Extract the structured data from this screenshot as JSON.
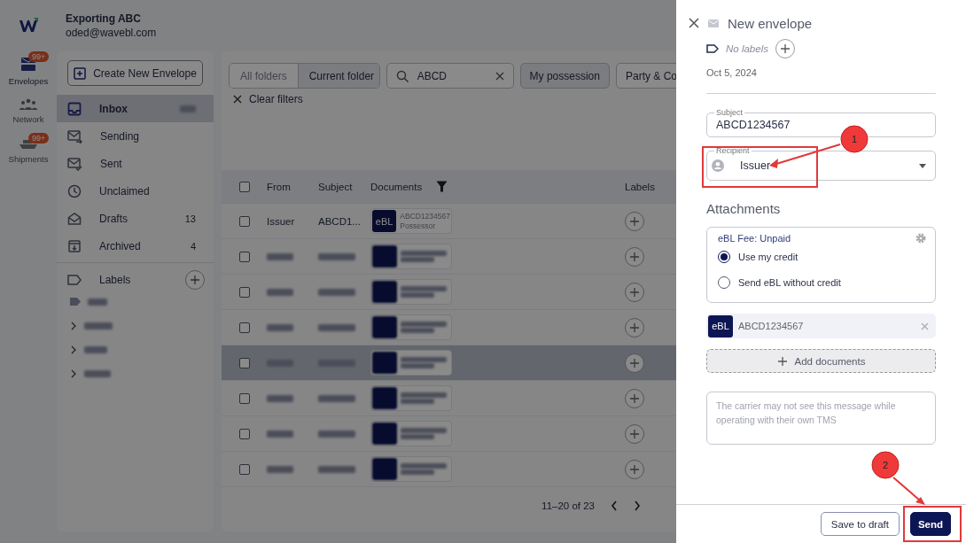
{
  "account": {
    "name": "Exporting ABC",
    "email": "oded@wavebl.com"
  },
  "rail": [
    {
      "label": "Envelopes",
      "badge": "99+",
      "selected": true
    },
    {
      "label": "Network",
      "selected": false
    },
    {
      "label": "Shipments",
      "badge": "99+",
      "selected": false
    }
  ],
  "create_button": "Create New Envelope",
  "folders": [
    {
      "label": "Inbox",
      "selected": true,
      "count_redacted": true
    },
    {
      "label": "Sending",
      "selected": false
    },
    {
      "label": "Sent",
      "selected": false
    },
    {
      "label": "Unclaimed",
      "selected": false
    },
    {
      "label": "Drafts",
      "selected": false,
      "count": "13"
    },
    {
      "label": "Archived",
      "selected": false,
      "count": "4"
    }
  ],
  "labels_section": {
    "title": "Labels",
    "items": [
      {
        "kind": "tag"
      },
      {
        "kind": "group"
      },
      {
        "kind": "group"
      },
      {
        "kind": "group"
      }
    ]
  },
  "scope_toggle": [
    {
      "label": "All folders",
      "selected": false
    },
    {
      "label": "Current folder",
      "selected": true
    }
  ],
  "search": {
    "value": "ABCD"
  },
  "filter_chips": [
    {
      "label": "My possession",
      "selected": true
    },
    {
      "label": "Party & Co",
      "selected": false
    }
  ],
  "clear_filters": "Clear filters",
  "table": {
    "columns": [
      "From",
      "Subject",
      "Documents",
      "Labels"
    ],
    "select_all_checked": false,
    "rows": [
      {
        "kind": "plain",
        "from": "Issuer",
        "subject": "ABCD1...",
        "doc_type": "eBL",
        "doc_number": "ABCD1234567",
        "doc_role": "Possessor",
        "hovered": false,
        "checked": false
      },
      {
        "kind": "redacted",
        "hovered": false,
        "checked": false
      },
      {
        "kind": "redacted",
        "hovered": false,
        "checked": false
      },
      {
        "kind": "redacted",
        "hovered": false,
        "checked": false
      },
      {
        "kind": "redacted",
        "hovered": true,
        "checked": false
      },
      {
        "kind": "redacted",
        "hovered": false,
        "checked": false
      },
      {
        "kind": "redacted",
        "hovered": false,
        "checked": false
      },
      {
        "kind": "redacted",
        "hovered": false,
        "checked": false
      }
    ]
  },
  "pagination": {
    "range": "11–20 of 23"
  },
  "drawer": {
    "title": "New envelope",
    "labels_text": "No labels",
    "date": "Oct 5, 2024",
    "subject": {
      "label": "Subject",
      "value": "ABCD1234567"
    },
    "recipient": {
      "label": "Recipient",
      "value": "Issuer"
    },
    "attachments_title": "Attachments",
    "fee": {
      "title": "eBL Fee: Unpaid",
      "options": [
        {
          "label": "Use my credit",
          "selected": true
        },
        {
          "label": "Send eBL without credit",
          "selected": false
        }
      ]
    },
    "documents": [
      {
        "type": "eBL",
        "number": "ABCD1234567"
      }
    ],
    "add_documents": "Add documents",
    "message": {
      "placeholder": "The carrier may not see this message while operating with their own TMS"
    },
    "buttons": [
      {
        "label": "Save to draft",
        "kind": "secondary"
      },
      {
        "label": "Send",
        "kind": "primary"
      }
    ]
  },
  "annotations": [
    {
      "number": "1"
    },
    {
      "number": "2"
    }
  ]
}
